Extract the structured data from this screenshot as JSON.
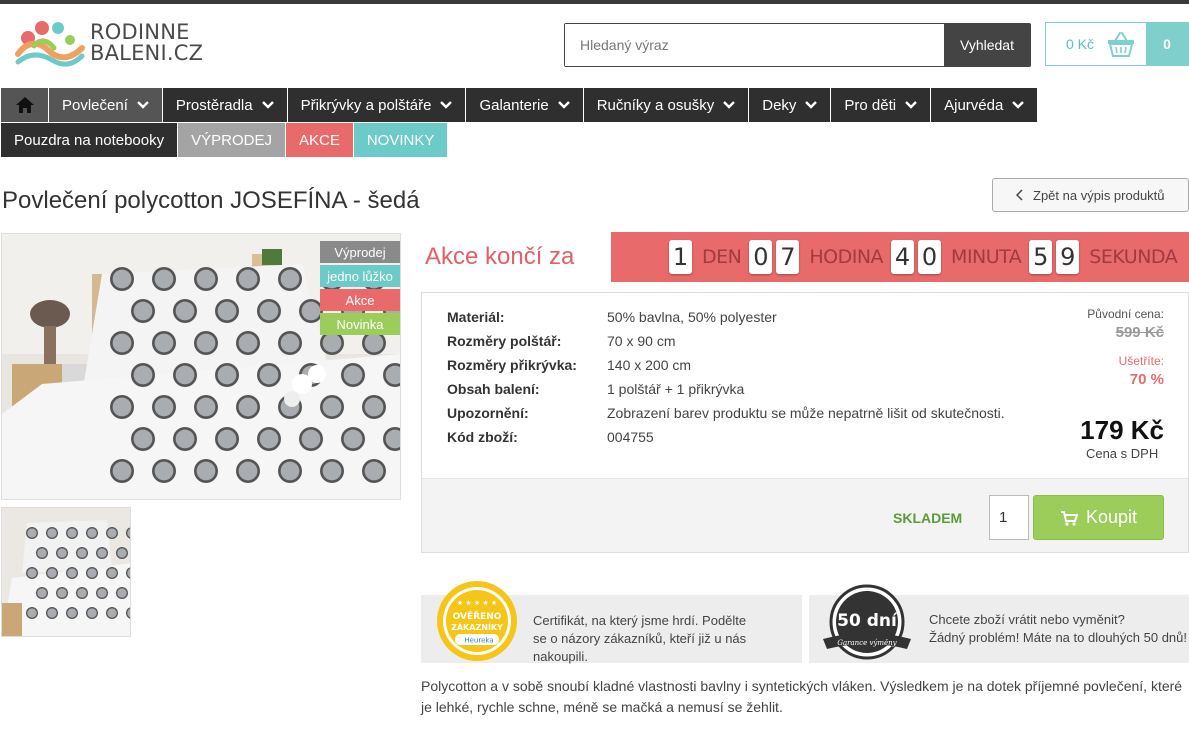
{
  "logo": {
    "line1": "RODINNE",
    "line2": "BALENI.CZ"
  },
  "search": {
    "placeholder": "Hledaný výraz",
    "button_label": "Vyhledat"
  },
  "cart": {
    "price": "0 Kč",
    "count": "0"
  },
  "nav": {
    "row1": [
      "Povlečení",
      "Prostěradla",
      "Přikrývky a polštáře",
      "Galanterie",
      "Ručníky a osušky",
      "Deky",
      "Pro děti",
      "Ajurvéda"
    ],
    "row2": [
      "Pouzdra na notebooky",
      "VÝPRODEJ",
      "AKCE",
      "NOVINKY"
    ]
  },
  "product": {
    "title": "Povlečení polycotton JOSEFÍNA - šedá",
    "back_label": "Zpět na výpis produktů",
    "labels": [
      "Výprodej",
      "jedno lůžko",
      "Akce",
      "Novinka"
    ]
  },
  "countdown": {
    "label": "Akce končí za",
    "days": [
      "1"
    ],
    "days_unit": "DEN",
    "hours": [
      "0",
      "7"
    ],
    "hours_unit": "HODINA",
    "minutes": [
      "4",
      "0"
    ],
    "minutes_unit": "MINUTA",
    "seconds": [
      "5",
      "9"
    ],
    "seconds_unit": "SEKUNDA"
  },
  "specs": [
    {
      "key": "Materiál:",
      "value": "50% bavlna, 50% polyester"
    },
    {
      "key": "Rozměry polštář:",
      "value": "70 x 90 cm"
    },
    {
      "key": "Rozměry přikrývka:",
      "value": "140 x 200 cm"
    },
    {
      "key": "Obsah balení:",
      "value": "1 polštář + 1 přikrývka"
    },
    {
      "key": "Upozornění:",
      "value": "Zobrazení barev produktu se může nepatrně lišit od skutečnosti."
    },
    {
      "key": "Kód zboží:",
      "value": "004755"
    }
  ],
  "pricing": {
    "original_label": "Původní cena:",
    "original_price": "599 Kč",
    "save_label": "Ušetříte:",
    "save_value": "70 %",
    "price": "179 Kč",
    "vat_note": "Cena s DPH"
  },
  "purchase": {
    "stock": "SKLADEM",
    "quantity": "1",
    "buy_label": "Koupit"
  },
  "badges": {
    "heureka": {
      "line1": "Certifikát, na který jsme hrdí. Podělte",
      "line2": "se o názory zákazníků, kteří již u nás nakoupili.",
      "seal_top": "OVĚŘENO",
      "seal_bottom": "ZÁKAZNÍKY",
      "seal_brand": "Heureka"
    },
    "return": {
      "line1": "Chcete zboží vrátit nebo vyměnit?",
      "line2": "Žádný problém! Máte na to dlouhých 50 dnů!",
      "seal_main": "50 dní",
      "seal_sub": "Garance výměny"
    }
  },
  "description": "Polycotton a v sobě snoubí kladné vlastnosti bavlny i syntetických vláken. Výsledkem je na dotek příjemné povlečení, které je lehké, rychle schne, méně se mačká a nemusí se žehlit.",
  "colors": {
    "accent_red": "#e86a6a",
    "teal": "#6ccbc8",
    "green": "#9ccc5a",
    "dark_nav": "#2f2f2f"
  }
}
